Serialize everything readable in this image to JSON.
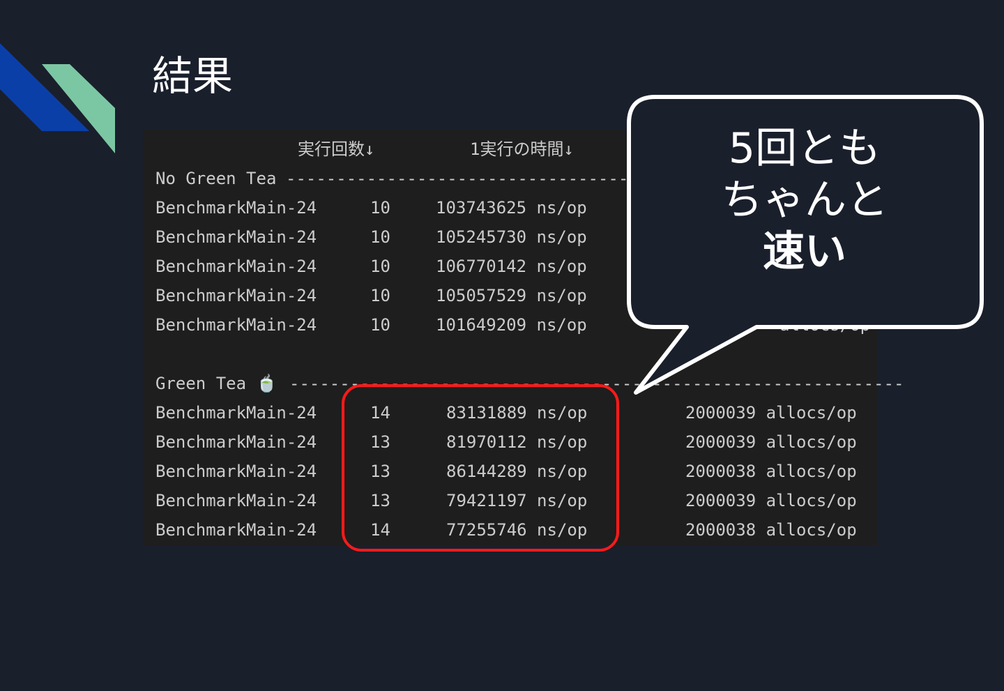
{
  "slide": {
    "title": "結果"
  },
  "terminal": {
    "header": {
      "runs": "実行回数↓",
      "time": "1実行の時間↓"
    },
    "group1": {
      "label": "No Green Tea",
      "dashes": "------------------------------------",
      "rows": [
        {
          "name": "BenchmarkMain-24",
          "runs": "10",
          "time": "103743625 ns/op"
        },
        {
          "name": "BenchmarkMain-24",
          "runs": "10",
          "time": "105245730 ns/op"
        },
        {
          "name": "BenchmarkMain-24",
          "runs": "10",
          "time": "106770142 ns/op"
        },
        {
          "name": "BenchmarkMain-24",
          "runs": "10",
          "time": "105057529 ns/op"
        },
        {
          "name": "BenchmarkMain-24",
          "runs": "10",
          "time": "101649209 ns/op"
        }
      ],
      "partial_allocs": "allocs/op"
    },
    "group2": {
      "label": "Green Tea 🍵",
      "dashes": "-------------------------------------------------------------",
      "rows": [
        {
          "name": "BenchmarkMain-24",
          "runs": "14",
          "time": "83131889 ns/op",
          "allocs": "2000039 allocs/op"
        },
        {
          "name": "BenchmarkMain-24",
          "runs": "13",
          "time": "81970112 ns/op",
          "allocs": "2000039 allocs/op"
        },
        {
          "name": "BenchmarkMain-24",
          "runs": "13",
          "time": "86144289 ns/op",
          "allocs": "2000038 allocs/op"
        },
        {
          "name": "BenchmarkMain-24",
          "runs": "13",
          "time": "79421197 ns/op",
          "allocs": "2000039 allocs/op"
        },
        {
          "name": "BenchmarkMain-24",
          "runs": "14",
          "time": "77255746 ns/op",
          "allocs": "2000038 allocs/op"
        }
      ]
    }
  },
  "callout": {
    "line1": "5回とも",
    "line2": "ちゃんと",
    "line3": "速い"
  },
  "colors": {
    "background": "#1a1f2c",
    "terminal": "#1e1e1e",
    "highlight": "#ff1a1a",
    "deco_blue": "#0b3fa8",
    "deco_green": "#7cc7a3"
  },
  "icons": {
    "tea": "hot-beverage-icon"
  }
}
